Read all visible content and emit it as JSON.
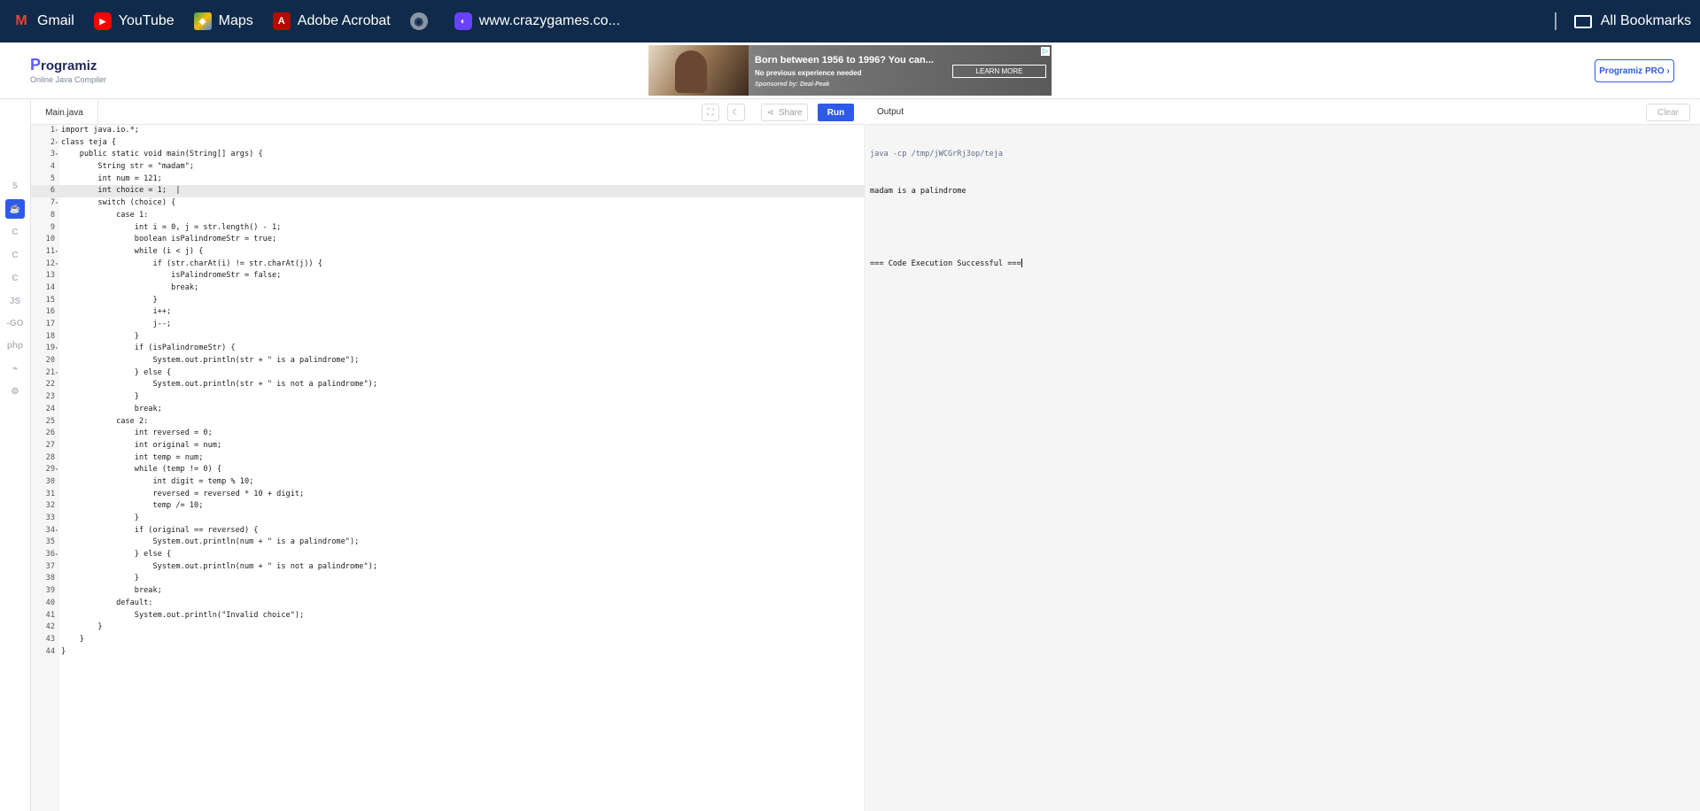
{
  "bookmarks": {
    "items": [
      {
        "label": "Gmail",
        "icon": "gmail-icon"
      },
      {
        "label": "YouTube",
        "icon": "youtube-icon"
      },
      {
        "label": "Maps",
        "icon": "maps-icon"
      },
      {
        "label": "Adobe Acrobat",
        "icon": "acrobat-icon"
      },
      {
        "label": "",
        "icon": "globe-icon"
      },
      {
        "label": "www.crazygames.co...",
        "icon": "crazygames-icon"
      }
    ],
    "all_bookmarks": "All Bookmarks"
  },
  "header": {
    "logo": "rogramiz",
    "logo_p": "P",
    "subtitle": "Online Java Compiler",
    "pro_button": "Programiz PRO ›"
  },
  "ad": {
    "headline": "Born between 1956 to 1996? You can...",
    "line2": "No previous experience needed",
    "line3": "Sponsored by: Deal-Peak",
    "button": "LEARN MORE",
    "badge": "▷"
  },
  "rail": {
    "items": [
      "python-icon",
      "r-icon",
      "sql-icon",
      "html-icon",
      "java-icon",
      "c-icon",
      "cpp-icon",
      "csharp-icon",
      "js-icon",
      "go-icon",
      "php-icon",
      "swift-icon",
      "rust-icon"
    ],
    "labels": [
      "",
      "",
      "",
      "5",
      "☕",
      "C",
      "C",
      "C",
      "JS",
      "-GO",
      "php",
      "⌁",
      "⚙"
    ]
  },
  "editor": {
    "file_tab": "Main.java",
    "share": "Share",
    "run": "Run",
    "current_line": 6,
    "lines": [
      "import java.io.*;",
      "class teja {",
      "    public static void main(String[] args) {",
      "        String str = \"madam\";",
      "        int num = 121;",
      "        int choice = 1;  |",
      "        switch (choice) {",
      "            case 1:",
      "                int i = 0, j = str.length() - 1;",
      "                boolean isPalindromeStr = true;",
      "                while (i < j) {",
      "                    if (str.charAt(i) != str.charAt(j)) {",
      "                        isPalindromeStr = false;",
      "                        break;",
      "                    }",
      "                    i++;",
      "                    j--;",
      "                }",
      "                if (isPalindromeStr) {",
      "                    System.out.println(str + \" is a palindrome\");",
      "                } else {",
      "                    System.out.println(str + \" is not a palindrome\");",
      "                }",
      "                break;",
      "            case 2:",
      "                int reversed = 0;",
      "                int original = num;",
      "                int temp = num;",
      "                while (temp != 0) {",
      "                    int digit = temp % 10;",
      "                    reversed = reversed * 10 + digit;",
      "                    temp /= 10;",
      "                }",
      "                if (original == reversed) {",
      "                    System.out.println(num + \" is a palindrome\");",
      "                } else {",
      "                    System.out.println(num + \" is not a palindrome\");",
      "                }",
      "                break;",
      "            default:",
      "                System.out.println(\"Invalid choice\");",
      "        }",
      "    }",
      "}"
    ],
    "fold_lines": [
      1,
      2,
      3,
      7,
      11,
      12,
      19,
      21,
      29,
      34,
      36
    ]
  },
  "output": {
    "title": "Output",
    "clear": "Clear",
    "command": "java -cp /tmp/jWCGrRj3op/teja",
    "lines": [
      "madam is a palindrome",
      "",
      "=== Code Execution Successful ==="
    ]
  }
}
